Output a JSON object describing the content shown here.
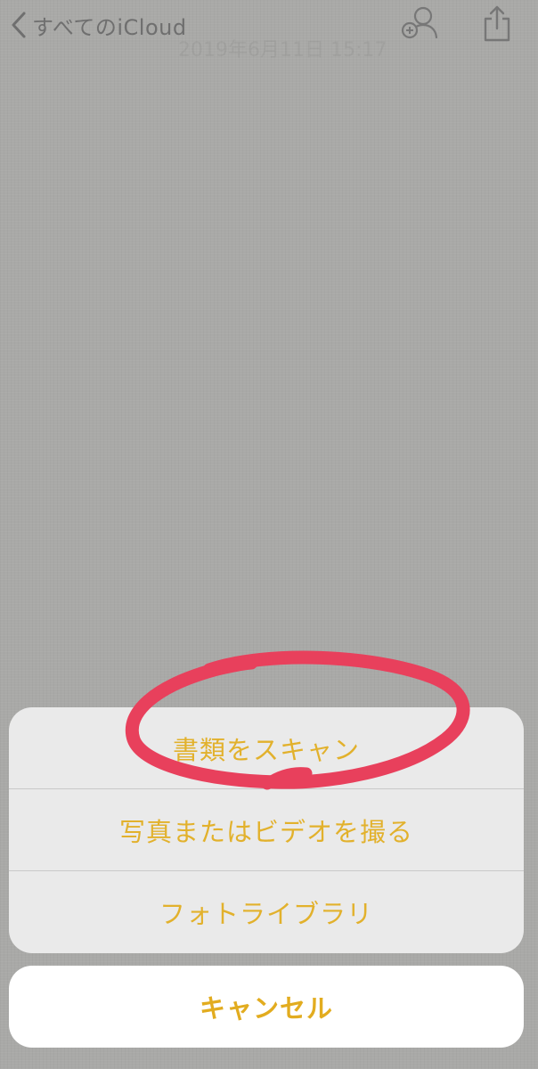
{
  "nav": {
    "back_label": "すべてのiCloud",
    "faint_title": "2019年6月11日 15:17"
  },
  "icons": {
    "back": "chevron-left-icon",
    "share_people": "add-person-icon",
    "share": "share-icon"
  },
  "action_sheet": {
    "items": [
      {
        "label": "書類をスキャン"
      },
      {
        "label": "写真またはビデオを撮る"
      },
      {
        "label": "フォトライブラリ"
      }
    ],
    "cancel_label": "キャンセル"
  },
  "colors": {
    "accent": "#e2b12c",
    "annotation": "#e8405c",
    "backdrop": "#a9a9a7"
  }
}
